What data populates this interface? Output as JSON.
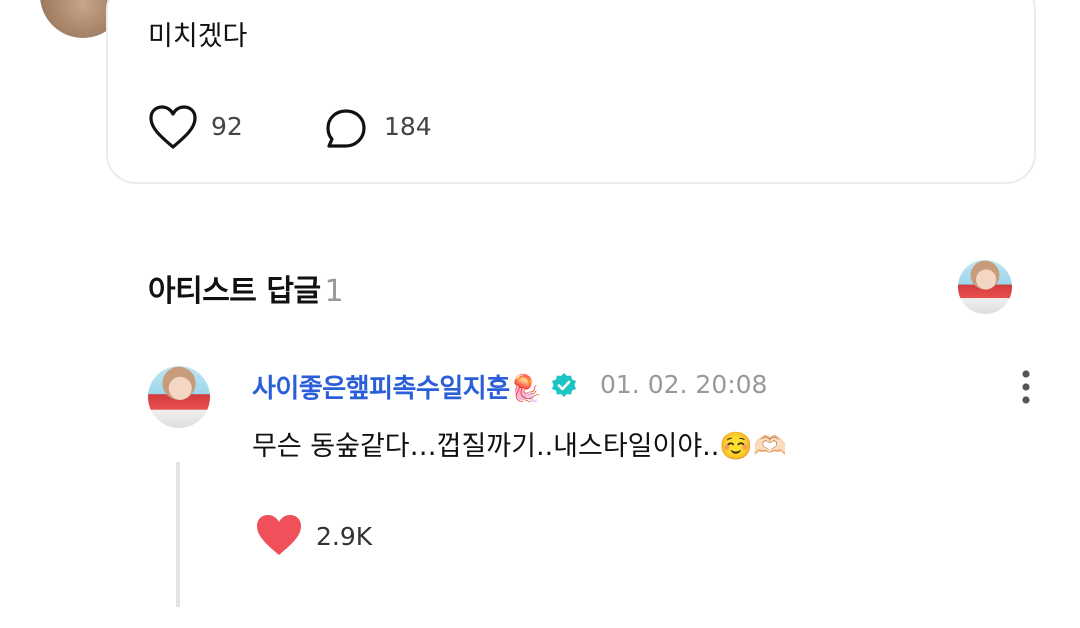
{
  "post": {
    "text": "미치겠다",
    "likes": "92",
    "comments": "184"
  },
  "artist_section": {
    "title": "아티스트 답글",
    "count": "1"
  },
  "reply": {
    "author": "사이좋은햎피촉수일지훈",
    "author_emoji": "🪼",
    "timestamp": "01. 02. 20:08",
    "text": "무슨 동숲같다…껍질까기..내스타일이야..",
    "text_emojis": "☺️🫶🏻",
    "likes": "2.9K"
  },
  "colors": {
    "accent_blue": "#2b5fd9",
    "verified": "#1ec4c4",
    "heart_red": "#f0505a"
  }
}
